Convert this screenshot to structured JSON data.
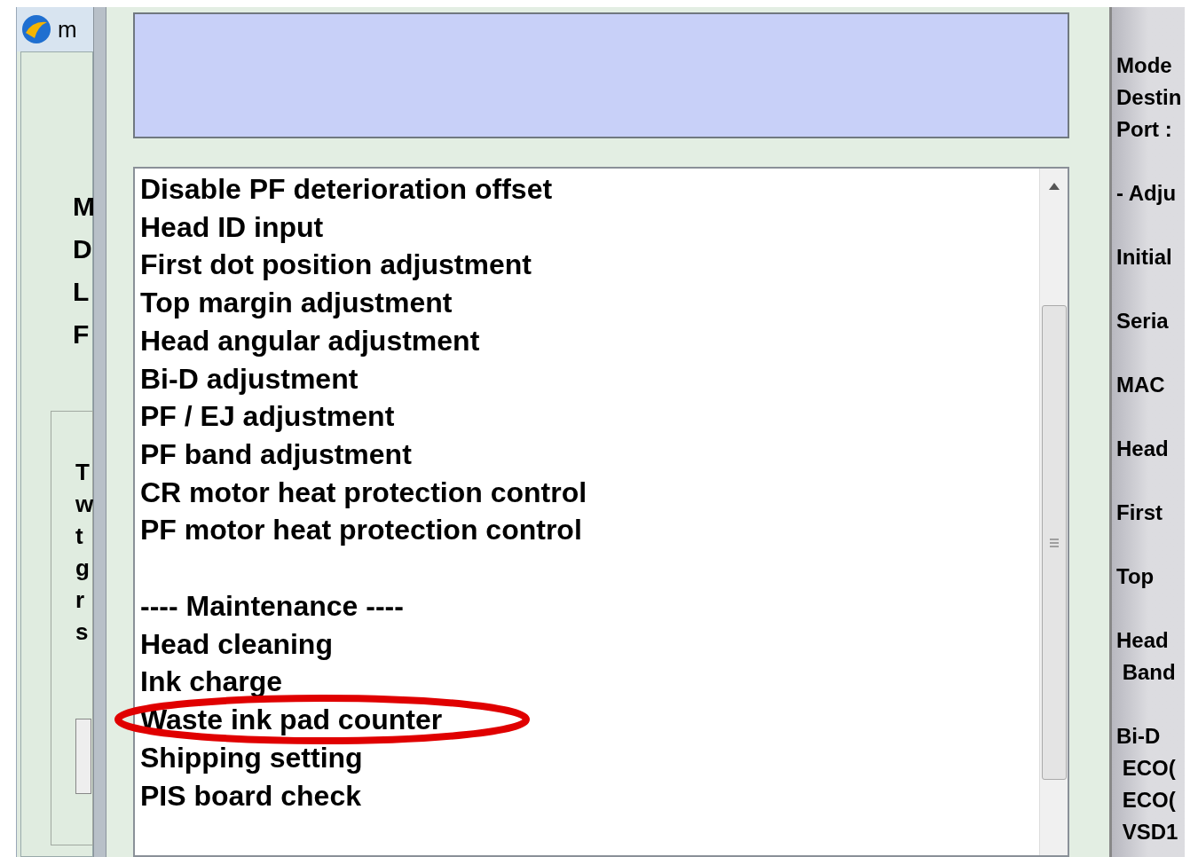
{
  "back_window": {
    "title": "m",
    "labels": [
      "M",
      "D",
      "L",
      "F"
    ],
    "group_text": [
      "T",
      "w",
      "t",
      "g",
      "r",
      "s"
    ]
  },
  "list": {
    "sections": [
      {
        "items": [
          "Disable PF deterioration offset",
          "Head ID input",
          "First dot position adjustment",
          "Top margin adjustment",
          "Head angular adjustment",
          "Bi-D adjustment",
          "PF / EJ adjustment",
          "PF band adjustment",
          "CR motor heat protection control",
          "PF motor heat protection control"
        ]
      },
      {
        "items": [
          "---- Maintenance ----",
          "Head cleaning",
          "Ink charge",
          "Waste ink pad counter",
          "Shipping setting",
          "PIS board check"
        ]
      }
    ]
  },
  "info_panel": {
    "groups": [
      {
        "lines": [
          "Mode",
          "Destin",
          "Port :"
        ]
      },
      {
        "lines": [
          "- Adju"
        ]
      },
      {
        "lines": [
          "Initial"
        ]
      },
      {
        "lines": [
          "Seria"
        ]
      },
      {
        "lines": [
          "MAC"
        ]
      },
      {
        "lines": [
          "Head"
        ]
      },
      {
        "lines": [
          "First"
        ]
      },
      {
        "lines": [
          "Top"
        ]
      },
      {
        "lines": [
          "Head",
          " Band"
        ]
      },
      {
        "lines": [
          "Bi-D",
          " ECO(",
          " ECO(",
          " VSD1"
        ]
      }
    ]
  }
}
